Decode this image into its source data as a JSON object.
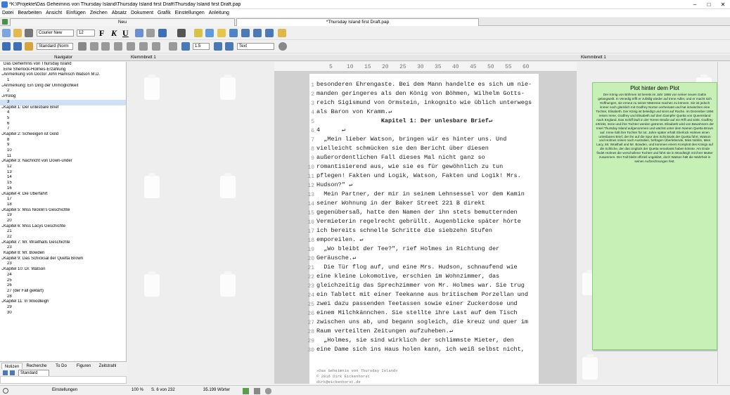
{
  "window": {
    "title": "*K:\\Projekte\\Das Geheimnis von Thursday Island\\Thursday Island first Draft\\Thursday Island first Draft.pap",
    "min": "–",
    "max": "□",
    "close": "✕"
  },
  "menu": [
    "Datei",
    "Bearbeiten",
    "Ansicht",
    "Einfügen",
    "Zeichen",
    "Absatz",
    "Dokument",
    "Grafik",
    "Einstellungen",
    "Anleitung"
  ],
  "tabs": {
    "new": "Neu",
    "doc": "*Thursday Island first Draft.pap"
  },
  "toolbar": {
    "font": "Courier New",
    "size": "12",
    "style": "Standard (Norm",
    "spacing": "1.5",
    "mode": "Text"
  },
  "panes": {
    "navigator": "Navigator",
    "corkboard": "Klemmbrett 1"
  },
  "navigator": [
    {
      "t": "Das Geheimnis von Thursday Island",
      "c": 0,
      "a": 0
    },
    {
      "t": "Eine Sherlock-Holmes-Erzählung",
      "c": 0,
      "a": 0
    },
    {
      "t": "Anmerkung von Doctor John Hamisch Watson M.D.",
      "c": 0,
      "a": 1
    },
    {
      "t": "1",
      "c": 1,
      "a": 0
    },
    {
      "t": "Anmerkung: Ein Ding der Unmöglichkeit",
      "c": 0,
      "a": 1
    },
    {
      "t": "2",
      "c": 1,
      "a": 0
    },
    {
      "t": "Prolog",
      "c": 0,
      "a": 1
    },
    {
      "t": "3",
      "c": 1,
      "a": 0,
      "h": 1
    },
    {
      "t": "Kapitel 1: Der unlesbare Brief",
      "c": 0,
      "a": 1
    },
    {
      "t": "4",
      "c": 1,
      "a": 0
    },
    {
      "t": "5",
      "c": 1,
      "a": 0
    },
    {
      "t": "6",
      "c": 1,
      "a": 0
    },
    {
      "t": "7",
      "c": 1,
      "a": 0
    },
    {
      "t": "Kapitel 2: Schweigen ist Gold",
      "c": 0,
      "a": 1
    },
    {
      "t": "8",
      "c": 1,
      "a": 0
    },
    {
      "t": "9",
      "c": 1,
      "a": 0
    },
    {
      "t": "10",
      "c": 1,
      "a": 0
    },
    {
      "t": "11",
      "c": 1,
      "a": 0
    },
    {
      "t": "Kapitel 3: Nachricht von Down-under",
      "c": 0,
      "a": 1
    },
    {
      "t": "12",
      "c": 1,
      "a": 0
    },
    {
      "t": "13",
      "c": 1,
      "a": 0
    },
    {
      "t": "14",
      "c": 1,
      "a": 0
    },
    {
      "t": "15",
      "c": 1,
      "a": 0
    },
    {
      "t": "16",
      "c": 1,
      "a": 0
    },
    {
      "t": "Kapitel 4: Die Überfahrt",
      "c": 0,
      "a": 1
    },
    {
      "t": "17",
      "c": 1,
      "a": 0
    },
    {
      "t": "18",
      "c": 1,
      "a": 0
    },
    {
      "t": "Kapitel 5: Miss Nicklin's Geschichte",
      "c": 0,
      "a": 1
    },
    {
      "t": "19",
      "c": 1,
      "a": 0
    },
    {
      "t": "20",
      "c": 1,
      "a": 0
    },
    {
      "t": "Kapitel 6: Miss Lacys Geschichte",
      "c": 0,
      "a": 1
    },
    {
      "t": "21",
      "c": 1,
      "a": 0
    },
    {
      "t": "22",
      "c": 1,
      "a": 0
    },
    {
      "t": "Kapitel 7: Mr. Wraithalls Geschichte",
      "c": 0,
      "a": 1
    },
    {
      "t": "23",
      "c": 1,
      "a": 0
    },
    {
      "t": "Kapitel 8: Mr. Bowden",
      "c": 0,
      "a": 0
    },
    {
      "t": "Kapitel 9: Das Schicksal der Quetta Brown",
      "c": 0,
      "a": 1
    },
    {
      "t": "23",
      "c": 1,
      "a": 0
    },
    {
      "t": "Kapitel 10: Dr. Watson",
      "c": 0,
      "a": 1
    },
    {
      "t": "24",
      "c": 1,
      "a": 0
    },
    {
      "t": "25",
      "c": 1,
      "a": 0
    },
    {
      "t": "26",
      "c": 1,
      "a": 0
    },
    {
      "t": "27 (der Fall geklärt)",
      "c": 1,
      "a": 0
    },
    {
      "t": "28",
      "c": 1,
      "a": 0
    },
    {
      "t": "Kapitel 11: In Woodleigh",
      "c": 0,
      "a": 1
    },
    {
      "t": "29",
      "c": 1,
      "a": 0
    },
    {
      "t": "30",
      "c": 1,
      "a": 0
    }
  ],
  "ruler": [
    "5",
    "10",
    "15",
    "20",
    "25",
    "30",
    "35",
    "40",
    "45",
    "50",
    "55",
    "60"
  ],
  "doc_lines": [
    {
      "n": "1",
      "t": "besonderen Ehrengaste. Bei dem Mann handelte es sich um nie-"
    },
    {
      "n": "2",
      "t": "manden geringeres als den König von Böhmen, Wilhelm Gotts-"
    },
    {
      "n": "3",
      "t": "reich Sigismund von Ormstein, inkognito wie üblich unterwegs"
    },
    {
      "n": "4",
      "t": "als Baron von Kramm.↵"
    },
    {
      "n": "5",
      "t": "                  Kapitel 1: Der unlesbare Brief↵",
      "b": 1
    },
    {
      "n": "6",
      "t": "4      ↵"
    },
    {
      "n": "7",
      "t": "  „Mein lieber Watson, bringen wir es hinter uns. Und"
    },
    {
      "n": "8",
      "t": "vielleicht schmücken sie den Bericht über diesen"
    },
    {
      "n": "9",
      "t": "außerordentlichen Fall dieses Mal nicht ganz so"
    },
    {
      "n": "10",
      "t": "romantisierend aus, wie sie es für gewöhnlich zu tun"
    },
    {
      "n": "11",
      "t": "pflegen! Fakten und Logik, Watson, Fakten und Logik! Mrs."
    },
    {
      "n": "12",
      "t": "Hudson?\" ↵"
    },
    {
      "n": "13",
      "t": "  Mein Partner, der mir in seinem Lehnsessel vor dem Kamin"
    },
    {
      "n": "14",
      "t": "seiner Wohnung in der Baker Street 221 B direkt"
    },
    {
      "n": "15",
      "t": "gegenübersaß, hatte den Namen der ihn stets bemutternden"
    },
    {
      "n": "16",
      "t": "Vermieterin regelrecht gebrüllt. Augenblicke später hörte"
    },
    {
      "n": "17",
      "t": "ich bereits schnelle Schritte die siebzehn Stufen"
    },
    {
      "n": "18",
      "t": "emporeilen. ↵"
    },
    {
      "n": "19",
      "t": "  „Wo bleibt der Tee?\", rief Holmes in Richtung der"
    },
    {
      "n": "20",
      "t": "Geräusche.↵"
    },
    {
      "n": "21",
      "t": "  Die Tür flog auf, und eine Mrs. Hudson, schnaufend wie"
    },
    {
      "n": "22",
      "t": "eine kleine Lokomotive, erschien im Wohnzimmer, das"
    },
    {
      "n": "23",
      "t": "gleichzeitig das Sprechzimmer von Mr. Holmes war. Sie trug"
    },
    {
      "n": "24",
      "t": "ein Tablett mit einer Teekanne aus britischem Porzellan und"
    },
    {
      "n": "25",
      "t": "zwei dazu passenden Teetassen sowie einer Zuckerdose und"
    },
    {
      "n": "26",
      "t": "einem Milchkännchen. Sie stellte ihre Last auf dem Tisch"
    },
    {
      "n": "27",
      "t": "zwischen uns ab, und begann sogleich, die kreuz und quer im"
    },
    {
      "n": "28",
      "t": "Raum verteilten Zeitungen aufzuheben.↵"
    },
    {
      "n": "29",
      "t": "  „Holmes, sie sind wirklich der schlimmste Mieter, den"
    },
    {
      "n": "30",
      "t": "eine Dame sich ins Haus holen kann, ich weiß selbst nicht,"
    }
  ],
  "footer": [
    "»Das Geheimnis von Thursday Island«",
    "© 2016 Dirk Eickenhorst",
    "dirk@eickenhorst.de"
  ],
  "plot": {
    "title": "Plot hinter dem Plot",
    "body": "Der König von Böhmen ist bereits im Jahr 1886 von seiner neuen Gattin gelangweilt. In Venedig trifft er zufällig wieder auf Irene Adler, und er macht sich Hoffnungen, sie erneut zu seiner Mätresse machen zu können. Sie ist jedoch immer noch glücklich mit Godfrey Norton verheiratet und hat inzwischen eine Tochter, Elisabeth. Der König ist beleidigt und sinnt auf Rache. Im Dezember 1894 reisen Irene, Godfrey und Elisabeth auf dem Dampfer Quetta von Queensland nach England. Das Schiff läuft in der Torres-Straße auf ein Riff und sinkt. Godfrey ertrinkt, Irene und ihre Tochter werden getrennt. Elisabeth wird von Bewohnern der Insel Thursday Island aufgenommen und wächst unter dem Namen Quetta Brown auf. Irene hält ihre Tochter für tot. Jahre später erhält Sherlock Holmes einen unlesbaren Brief, der ihn auf die Spur des Schicksals der Quetta führt. Watson und Holmes reisen nach Australien, befragen Überlebende, Miss Nicklin, Miss Lacy, Mr. Wraithall und Mr. Bowden, und kommen einem Komplott des Königs auf die Schliche, der das Unglück der Quetta veranlasst haben könnte. Am Ende findet Holmes die verschollene Tochter und führt sie in Woodleigh mit ihrer Mutter zusammen. Der Fall bleibt offiziell ungeklärt, doch Watson hält die Wahrheit in seinen Aufzeichnungen fest."
  },
  "bottom_tabs": [
    "Notizen",
    "Recherche",
    "To Do",
    "Figuren",
    "Zeitstrahl"
  ],
  "notes_style": "Standard",
  "status": {
    "settings": "Einstellungen",
    "zoom": "100 %",
    "page": "S. 6 von 232",
    "words": "35.199 Wörter"
  }
}
